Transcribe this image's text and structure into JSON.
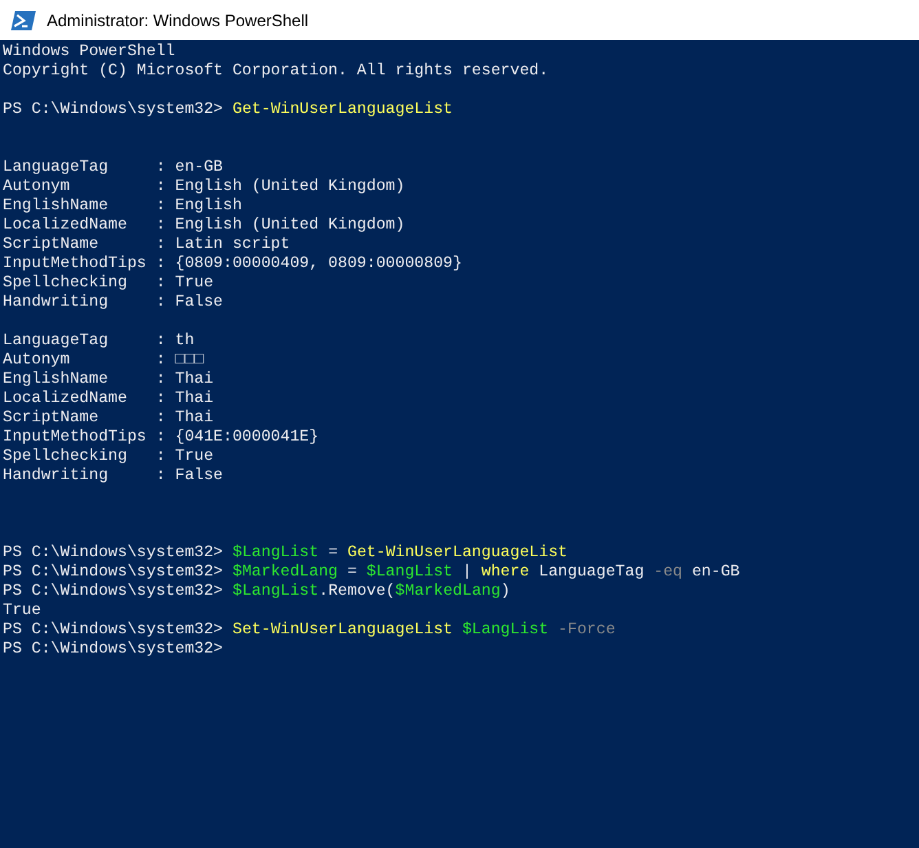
{
  "window": {
    "title": "Administrator: Windows PowerShell"
  },
  "console": {
    "lines": [
      {
        "kind": "text",
        "tokens": [
          {
            "text": "Windows PowerShell",
            "kind": "plain"
          }
        ]
      },
      {
        "kind": "text",
        "tokens": [
          {
            "text": "Copyright (C) Microsoft Corporation. All rights reserved.",
            "kind": "plain"
          }
        ]
      },
      {
        "kind": "blank"
      },
      {
        "kind": "text",
        "tokens": [
          {
            "text": "PS C:\\Windows\\system32> ",
            "kind": "plain"
          },
          {
            "text": "Get-WinUserLanguageList",
            "kind": "command"
          }
        ]
      },
      {
        "kind": "blank"
      },
      {
        "kind": "blank"
      },
      {
        "kind": "text",
        "tokens": [
          {
            "text": "LanguageTag     : en-GB",
            "kind": "plain"
          }
        ]
      },
      {
        "kind": "text",
        "tokens": [
          {
            "text": "Autonym         : English (United Kingdom)",
            "kind": "plain"
          }
        ]
      },
      {
        "kind": "text",
        "tokens": [
          {
            "text": "EnglishName     : English",
            "kind": "plain"
          }
        ]
      },
      {
        "kind": "text",
        "tokens": [
          {
            "text": "LocalizedName   : English (United Kingdom)",
            "kind": "plain"
          }
        ]
      },
      {
        "kind": "text",
        "tokens": [
          {
            "text": "ScriptName      : Latin script",
            "kind": "plain"
          }
        ]
      },
      {
        "kind": "text",
        "tokens": [
          {
            "text": "InputMethodTips : {0809:00000409, 0809:00000809}",
            "kind": "plain"
          }
        ]
      },
      {
        "kind": "text",
        "tokens": [
          {
            "text": "Spellchecking   : True",
            "kind": "plain"
          }
        ]
      },
      {
        "kind": "text",
        "tokens": [
          {
            "text": "Handwriting     : False",
            "kind": "plain"
          }
        ]
      },
      {
        "kind": "blank"
      },
      {
        "kind": "text",
        "tokens": [
          {
            "text": "LanguageTag     : th",
            "kind": "plain"
          }
        ]
      },
      {
        "kind": "text",
        "tokens": [
          {
            "text": "Autonym         : □□□",
            "kind": "plain"
          }
        ]
      },
      {
        "kind": "text",
        "tokens": [
          {
            "text": "EnglishName     : Thai",
            "kind": "plain"
          }
        ]
      },
      {
        "kind": "text",
        "tokens": [
          {
            "text": "LocalizedName   : Thai",
            "kind": "plain"
          }
        ]
      },
      {
        "kind": "text",
        "tokens": [
          {
            "text": "ScriptName      : Thai",
            "kind": "plain"
          }
        ]
      },
      {
        "kind": "text",
        "tokens": [
          {
            "text": "InputMethodTips : {041E:0000041E}",
            "kind": "plain"
          }
        ]
      },
      {
        "kind": "text",
        "tokens": [
          {
            "text": "Spellchecking   : True",
            "kind": "plain"
          }
        ]
      },
      {
        "kind": "text",
        "tokens": [
          {
            "text": "Handwriting     : False",
            "kind": "plain"
          }
        ]
      },
      {
        "kind": "blank"
      },
      {
        "kind": "blank"
      },
      {
        "kind": "blank"
      },
      {
        "kind": "text",
        "tokens": [
          {
            "text": "PS C:\\Windows\\system32> ",
            "kind": "plain"
          },
          {
            "text": "$LangList",
            "kind": "variable"
          },
          {
            "text": " = ",
            "kind": "plain"
          },
          {
            "text": "Get-WinUserLanguageList",
            "kind": "command"
          }
        ]
      },
      {
        "kind": "text",
        "tokens": [
          {
            "text": "PS C:\\Windows\\system32> ",
            "kind": "plain"
          },
          {
            "text": "$MarkedLang",
            "kind": "variable"
          },
          {
            "text": " = ",
            "kind": "plain"
          },
          {
            "text": "$LangList",
            "kind": "variable"
          },
          {
            "text": " | ",
            "kind": "plain"
          },
          {
            "text": "where",
            "kind": "command"
          },
          {
            "text": " LanguageTag ",
            "kind": "plain"
          },
          {
            "text": "-eq",
            "kind": "operator"
          },
          {
            "text": " en-GB",
            "kind": "plain"
          }
        ]
      },
      {
        "kind": "text",
        "tokens": [
          {
            "text": "PS C:\\Windows\\system32> ",
            "kind": "plain"
          },
          {
            "text": "$LangList",
            "kind": "variable"
          },
          {
            "text": ".Remove(",
            "kind": "plain"
          },
          {
            "text": "$MarkedLang",
            "kind": "variable"
          },
          {
            "text": ")",
            "kind": "plain"
          }
        ]
      },
      {
        "kind": "text",
        "tokens": [
          {
            "text": "True",
            "kind": "plain"
          }
        ]
      },
      {
        "kind": "text",
        "tokens": [
          {
            "text": "PS C:\\Windows\\system32> ",
            "kind": "plain"
          },
          {
            "text": "Set-WinUserLanguageList ",
            "kind": "command"
          },
          {
            "text": "$LangList ",
            "kind": "variable"
          },
          {
            "text": "-Force",
            "kind": "operator"
          }
        ]
      },
      {
        "kind": "text",
        "tokens": [
          {
            "text": "PS C:\\Windows\\system32> ",
            "kind": "plain"
          }
        ]
      }
    ]
  }
}
